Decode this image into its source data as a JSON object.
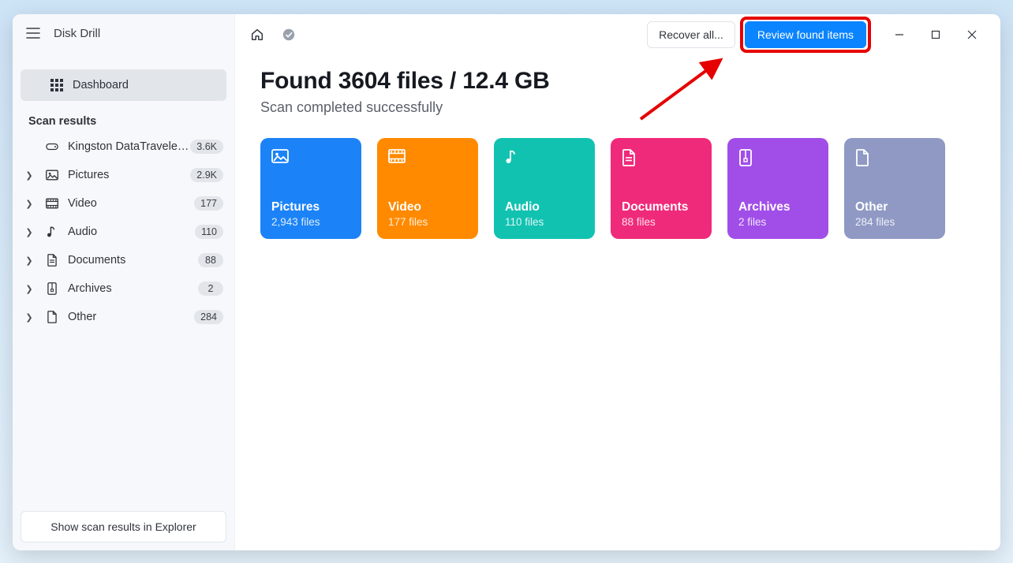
{
  "app": {
    "title": "Disk Drill"
  },
  "sidebar": {
    "dashboard_label": "Dashboard",
    "section_label": "Scan results",
    "device": {
      "label": "Kingston DataTraveler 2....",
      "badge": "3.6K"
    },
    "items": [
      {
        "id": "pictures",
        "label": "Pictures",
        "badge": "2.9K",
        "icon": "image-icon"
      },
      {
        "id": "video",
        "label": "Video",
        "badge": "177",
        "icon": "film-icon"
      },
      {
        "id": "audio",
        "label": "Audio",
        "badge": "110",
        "icon": "music-icon"
      },
      {
        "id": "documents",
        "label": "Documents",
        "badge": "88",
        "icon": "document-icon"
      },
      {
        "id": "archives",
        "label": "Archives",
        "badge": "2",
        "icon": "archive-icon"
      },
      {
        "id": "other",
        "label": "Other",
        "badge": "284",
        "icon": "file-icon"
      }
    ],
    "footer_label": "Show scan results in Explorer"
  },
  "toolbar": {
    "recover_label": "Recover all...",
    "review_label": "Review found items"
  },
  "main": {
    "headline": "Found 3604 files / 12.4 GB",
    "subline": "Scan completed successfully",
    "cards": [
      {
        "id": "pictures",
        "title": "Pictures",
        "sub": "2,943 files",
        "bg": "#1b83f7",
        "icon": "image-icon"
      },
      {
        "id": "video",
        "title": "Video",
        "sub": "177 files",
        "bg": "#ff8a00",
        "icon": "film-icon"
      },
      {
        "id": "audio",
        "title": "Audio",
        "sub": "110 files",
        "bg": "#12c2b1",
        "icon": "music-icon"
      },
      {
        "id": "documents",
        "title": "Documents",
        "sub": "88 files",
        "bg": "#f02a7a",
        "icon": "document-icon"
      },
      {
        "id": "archives",
        "title": "Archives",
        "sub": "2 files",
        "bg": "#a14ee8",
        "icon": "archive-icon"
      },
      {
        "id": "other",
        "title": "Other",
        "sub": "284 files",
        "bg": "#8f99c4",
        "icon": "file-icon"
      }
    ]
  },
  "annotation": {
    "highlight_target": "review-button"
  }
}
